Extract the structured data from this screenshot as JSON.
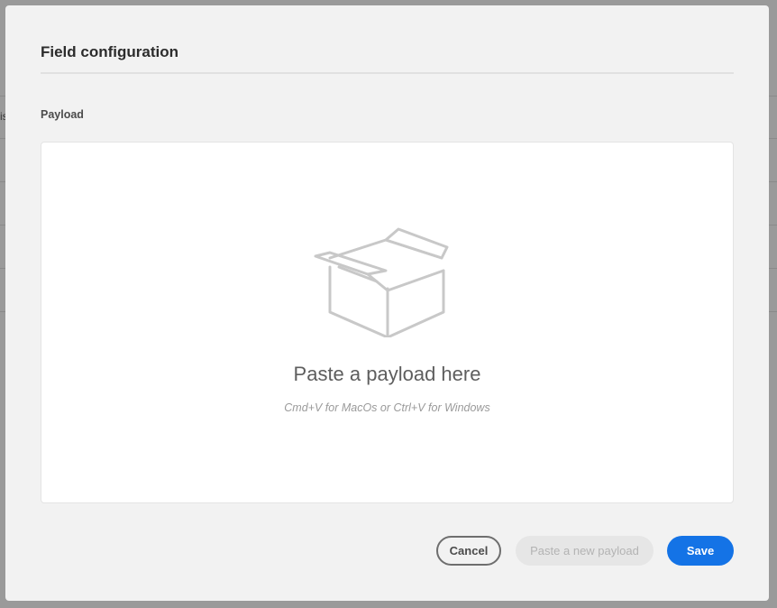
{
  "background": {
    "row_fragment": "is"
  },
  "dialog": {
    "title": "Field configuration",
    "field_label": "Payload",
    "dropzone": {
      "icon": "open-box-icon",
      "heading": "Paste a payload here",
      "hint": "Cmd+V for MacOs or Ctrl+V for Windows"
    },
    "buttons": {
      "cancel": "Cancel",
      "paste_new": "Paste a new payload",
      "save": "Save"
    }
  },
  "colors": {
    "accent": "#1473e6",
    "overlay": "#9a9a9a",
    "dialog_bg": "#f2f2f2"
  }
}
